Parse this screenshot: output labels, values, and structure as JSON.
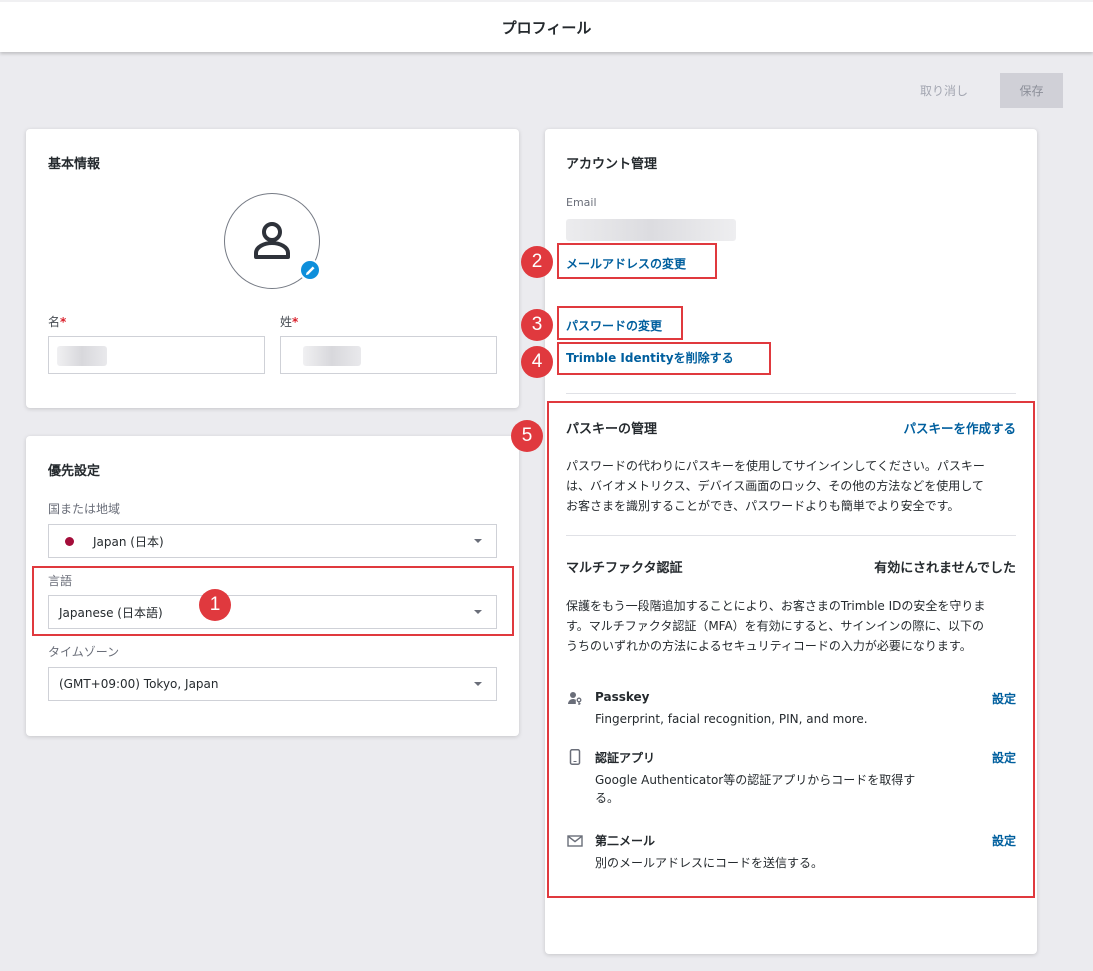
{
  "header": {
    "title": "プロフィール"
  },
  "actions": {
    "cancel": "取り消し",
    "save": "保存"
  },
  "basic_info": {
    "title": "基本情報",
    "first_name_label": "名",
    "last_name_label": "姓",
    "required_mark": "*"
  },
  "preferences": {
    "title": "優先設定",
    "country_label": "国または地域",
    "country_value": "Japan (日本)",
    "language_label": "言語",
    "language_value": "Japanese (日本語)",
    "timezone_label": "タイムゾーン",
    "timezone_value": "(GMT+09:00) Tokyo, Japan"
  },
  "account": {
    "title": "アカウント管理",
    "email_label": "Email",
    "change_email": "メールアドレスの変更",
    "change_password": "パスワードの変更",
    "delete_identity": "Trimble Identityを削除する",
    "passkey": {
      "title": "パスキーの管理",
      "create_link": "パスキーを作成する",
      "description_lines": [
        "パスワードの代わりにパスキーを使用してサインインしてください。パスキー",
        "は、バイオメトリクス、デバイス画面のロック、その他の方法などを使用して",
        "お客さまを識別することができ、パスワードよりも簡単でより安全です。"
      ]
    },
    "mfa": {
      "title": "マルチファクタ認証",
      "status": "有効にされませんでした",
      "description_lines": [
        "保護をもう一段階追加することにより、お客さまのTrimble IDの安全を守りま",
        "す。マルチファクタ認証（MFA）を有効にすると、サインインの際に、以下の",
        "うちのいずれかの方法によるセキュリティコードの入力が必要になります。"
      ],
      "methods": [
        {
          "name": "Passkey",
          "icon": "person-key-icon",
          "desc_lines": [
            "Fingerprint, facial recognition, PIN, and more."
          ],
          "action": "設定"
        },
        {
          "name": "認証アプリ",
          "icon": "phone-icon",
          "desc_lines": [
            "Google Authenticator等の認証アプリからコードを取得す",
            "る。"
          ],
          "action": "設定"
        },
        {
          "name": "第二メール",
          "icon": "mail-icon",
          "desc_lines": [
            "別のメールアドレスにコードを送信する。"
          ],
          "action": "設定"
        }
      ]
    }
  },
  "annotations": [
    "1",
    "2",
    "3",
    "4",
    "5"
  ],
  "colors": {
    "link": "#005f9e",
    "annotation": "#e0393e",
    "avatar_edit": "#0e8fdb",
    "flag": "#a40d3a"
  }
}
